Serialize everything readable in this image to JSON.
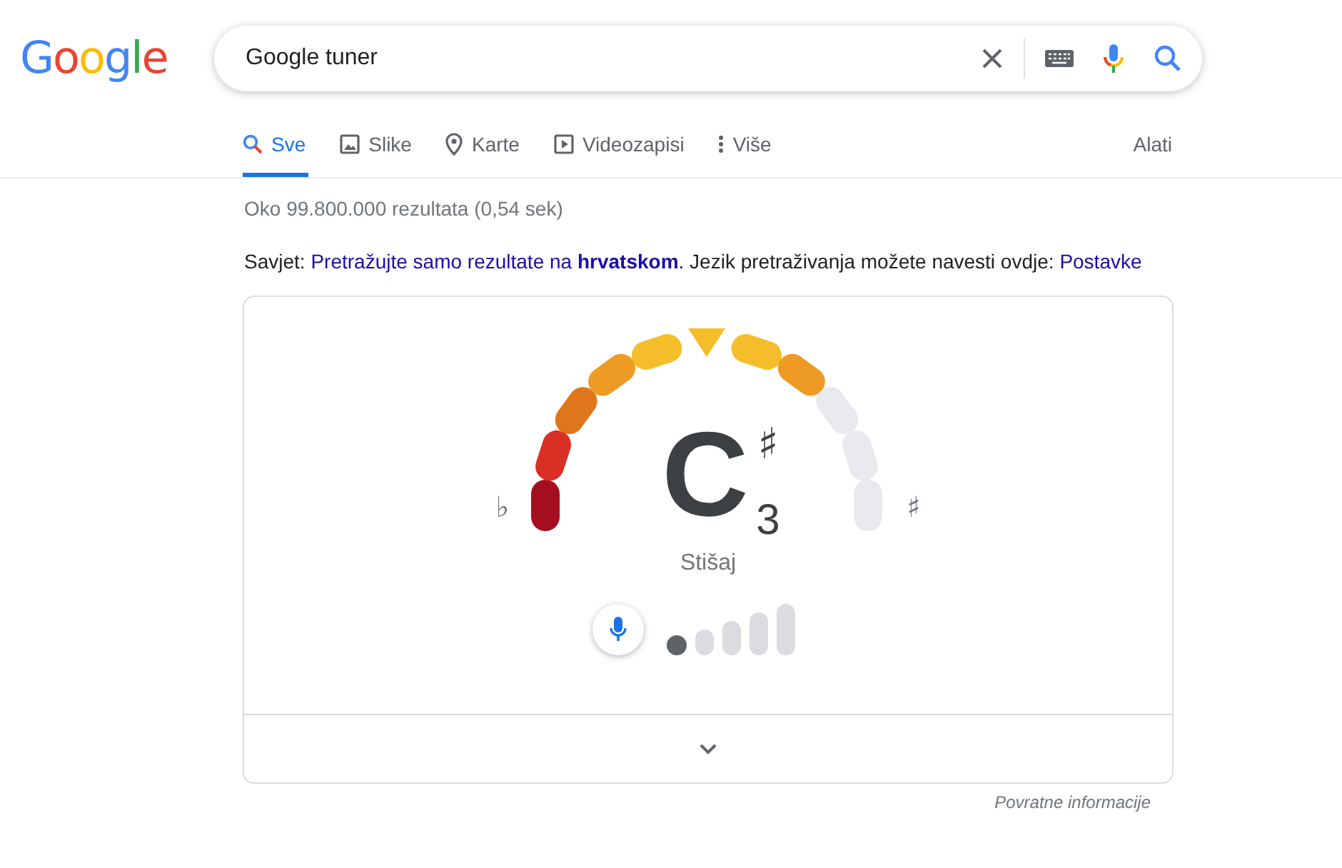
{
  "logo": "Google",
  "search": {
    "value": "Google tuner"
  },
  "tabs": [
    {
      "label": "Sve",
      "kind": "search",
      "selected": true
    },
    {
      "label": "Slike",
      "kind": "image",
      "selected": false
    },
    {
      "label": "Karte",
      "kind": "pin",
      "selected": false
    },
    {
      "label": "Videozapisi",
      "kind": "video",
      "selected": false
    },
    {
      "label": "Više",
      "kind": "more",
      "selected": false
    }
  ],
  "tools": "Alati",
  "result_stats": "Oko 99.800.000 rezultata (0,54 sek)",
  "tip": {
    "prefix": "Savjet: ",
    "language_link": "Pretražujte samo rezultate na **hrvatskom**",
    "middle": ". Jezik pretraživanja možete navesti ovdje: ",
    "settings_link": "Postavke"
  },
  "tuner": {
    "note": "C",
    "accidental": "♯",
    "octave": "3",
    "flat_label": "♭",
    "sharp_label": "♯",
    "status": "Stišaj",
    "level": 0.2,
    "segments": [
      {
        "color": "#a50e1e"
      },
      {
        "color": "#d93025"
      },
      {
        "color": "#e0761c"
      },
      {
        "color": "#ee9b25"
      },
      {
        "color": "#f6bd2b"
      },
      {
        "color": "#f6bd2b"
      },
      {
        "color": "#ee9b25"
      },
      {
        "color": "#e8eaed"
      },
      {
        "color": "#e8eaed"
      },
      {
        "color": "#e8eaed"
      }
    ]
  },
  "feedback": "Povratne informacije"
}
